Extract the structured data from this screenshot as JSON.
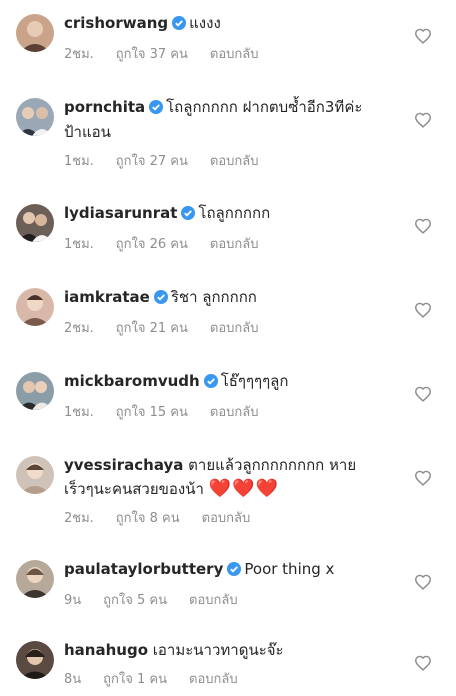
{
  "comments": [
    {
      "username": "crishorwang",
      "verified": true,
      "text": "แงงง",
      "text2": "",
      "hearts": "",
      "time": "2ชม.",
      "likes": "ถูกใจ 37 คน",
      "reply": "ตอบกลับ",
      "avatar_color": "#c9a48a"
    },
    {
      "username": "pornchita",
      "verified": true,
      "text": "โถลูกกกกก ฝากตบซ้ำอีก3ทีค่ะ",
      "text2": "ป้าแอน",
      "hearts": "",
      "time": "1ชม.",
      "likes": "ถูกใจ 27 คน",
      "reply": "ตอบกลับ",
      "avatar_color": "#9aa7b5"
    },
    {
      "username": "lydiasarunrat",
      "verified": true,
      "text": "โถลูกกกกก",
      "text2": "",
      "hearts": "",
      "time": "1ชม.",
      "likes": "ถูกใจ 26 คน",
      "reply": "ตอบกลับ",
      "avatar_color": "#6b5f58"
    },
    {
      "username": "iamkratae",
      "verified": true,
      "text": "ริชา ลูกกกกก",
      "text2": "",
      "hearts": "",
      "time": "2ชม.",
      "likes": "ถูกใจ 21 คน",
      "reply": "ตอบกลับ",
      "avatar_color": "#d8b8a8"
    },
    {
      "username": "mickbaromvudh",
      "verified": true,
      "text": "โธ๊ๆๆๆๆลูก",
      "text2": "",
      "hearts": "",
      "time": "1ชม.",
      "likes": "ถูกใจ 15 คน",
      "reply": "ตอบกลับ",
      "avatar_color": "#8b9ea8"
    },
    {
      "username": "yvessirachaya",
      "verified": false,
      "text": "ตายแล้วลูกกกกกกกก หาย",
      "text2": "เร็วๆนะคนสวยของน้า",
      "hearts": "❤️❤️❤️",
      "time": "2ชม.",
      "likes": "ถูกใจ 8 คน",
      "reply": "ตอบกลับ",
      "avatar_color": "#cfc2b8"
    },
    {
      "username": "paulataylorbuttery",
      "verified": true,
      "text": "Poor thing x",
      "text2": "",
      "hearts": "",
      "time": "9น",
      "likes": "ถูกใจ 5 คน",
      "reply": "ตอบกลับ",
      "avatar_color": "#b7a99a"
    },
    {
      "username": "hanahugo",
      "verified": false,
      "text": "เอามะนาวทาดูนะจ๊ะ",
      "text2": "",
      "hearts": "",
      "time": "8น",
      "likes": "ถูกใจ 1 คน",
      "reply": "ตอบกลับ",
      "avatar_color": "#5a4a42"
    }
  ],
  "colors": {
    "text": "#262626",
    "meta": "#8e8e8e",
    "verified": "#3897f0",
    "heart_outline": "#8e8e8e"
  },
  "icons": {
    "like": "heart-outline-icon",
    "verified": "verified-badge-icon"
  }
}
